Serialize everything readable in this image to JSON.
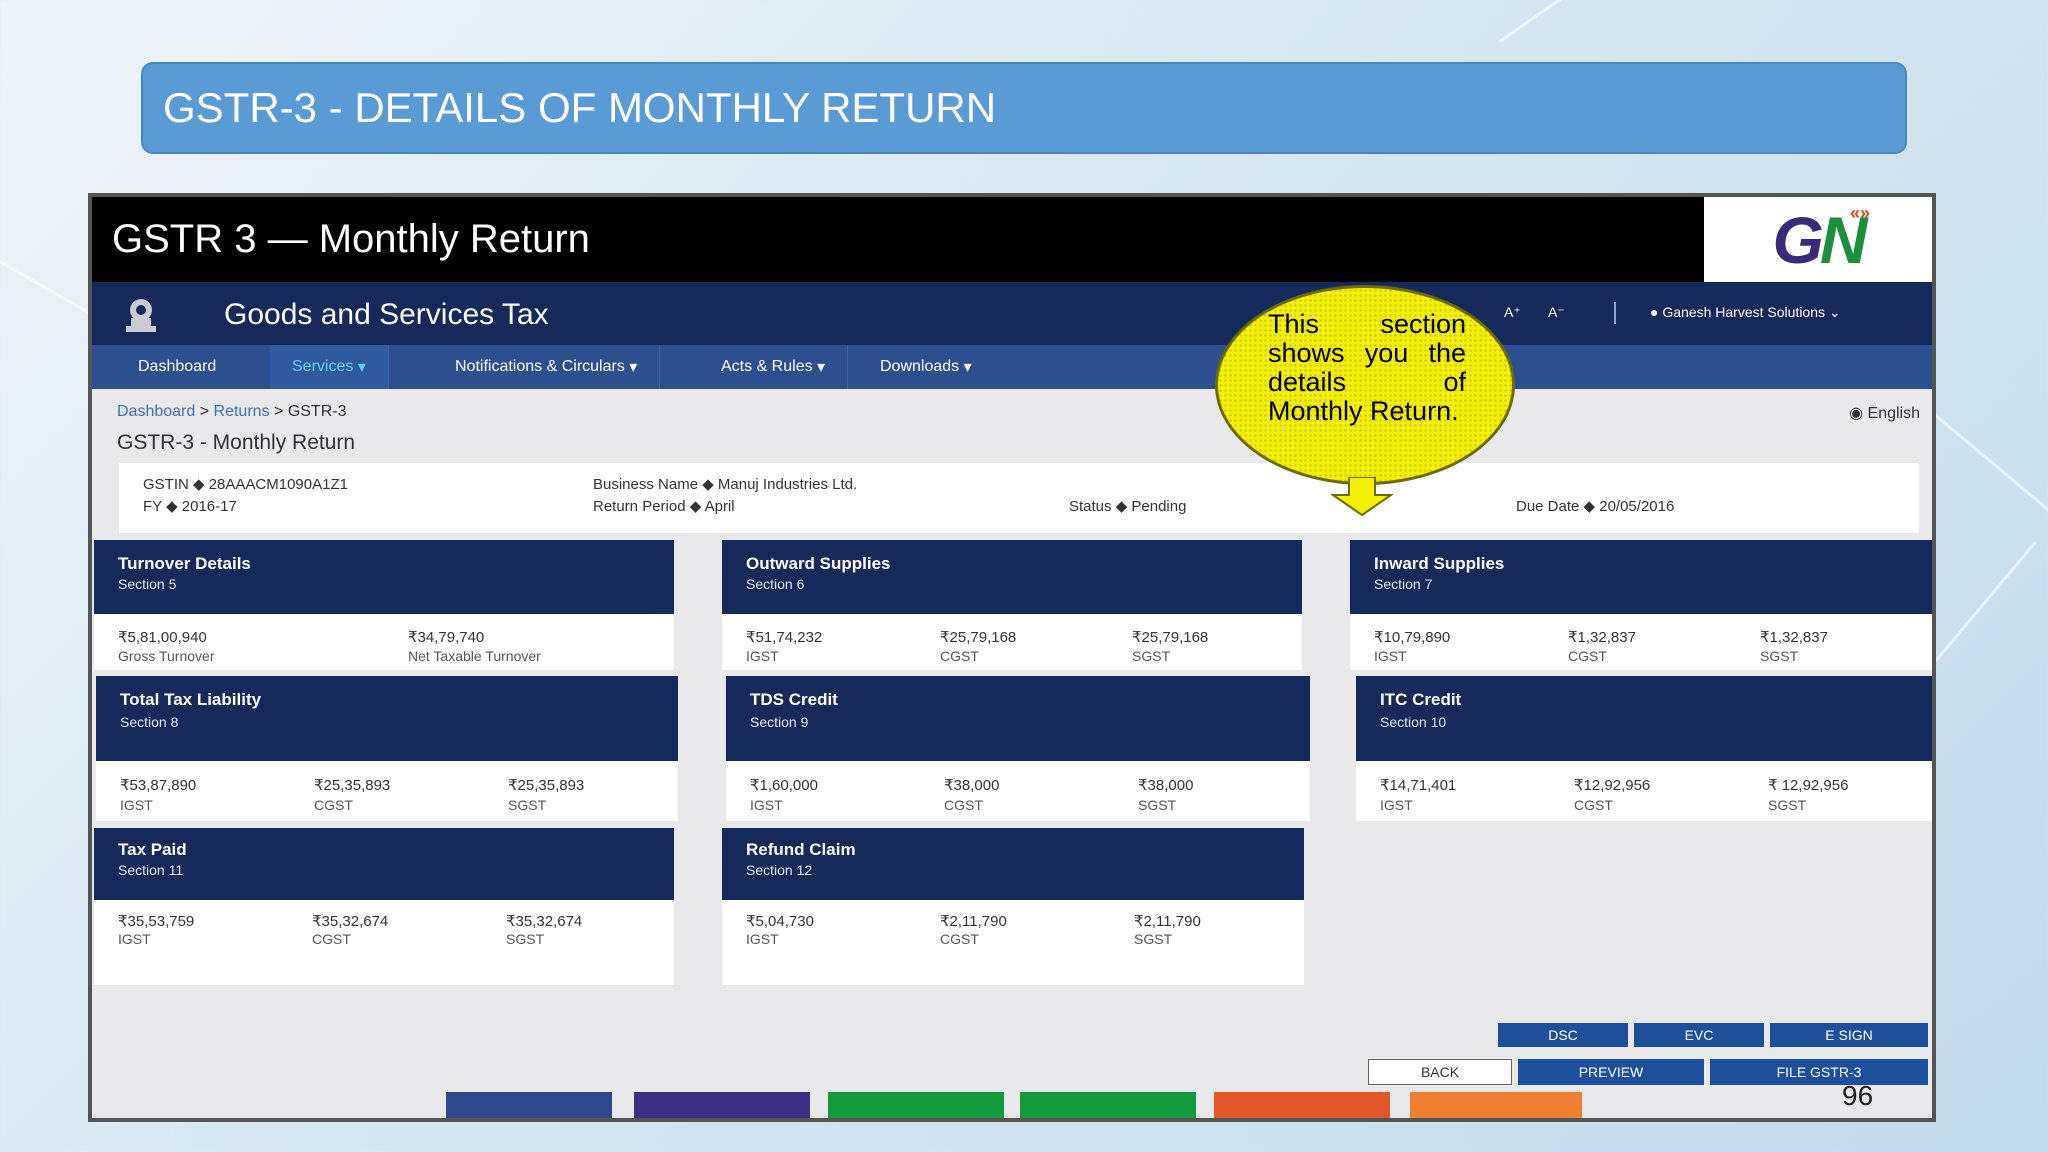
{
  "slide": {
    "title": "GSTR-3 - DETAILS OF MONTHLY RETURN",
    "page_number": "96"
  },
  "portal": {
    "window_title": "GSTR 3 — Monthly Return",
    "site_name": "Goods and Services Tax",
    "font_increase": "A⁺",
    "font_decrease": "A⁻",
    "user_name": "Ganesh Harvest Solutions",
    "language": "English"
  },
  "nav": [
    {
      "label": "Dashboard"
    },
    {
      "label": "Services"
    },
    {
      "label": "Notifications & Circulars"
    },
    {
      "label": "Acts & Rules"
    },
    {
      "label": "Downloads"
    }
  ],
  "breadcrumb": [
    "Dashboard",
    "Returns",
    "GSTR-3"
  ],
  "page_heading": "GSTR-3 - Monthly Return",
  "info": {
    "gstin": "GSTIN ◆ 28AAACM1090A1Z1",
    "fy": "FY ◆ 2016-17",
    "business_name": "Business Name ◆ Manuj Industries Ltd.",
    "return_period": "Return Period ◆ April",
    "status": "Status ◆ Pending",
    "due_date": "Due Date ◆ 20/05/2016"
  },
  "callout": {
    "text": "This section shows you the details of Monthly Return."
  },
  "cards": {
    "turnover": {
      "title": "Turnover Details",
      "section": "Section 5",
      "values": [
        {
          "value": "₹5,81,00,940",
          "label": "Gross Turnover"
        },
        {
          "value": "₹34,79,740",
          "label": "Net Taxable Turnover"
        }
      ]
    },
    "outward": {
      "title": "Outward Supplies",
      "section": "Section 6",
      "values": [
        {
          "value": "₹51,74,232",
          "label": "IGST"
        },
        {
          "value": "₹25,79,168",
          "label": "CGST"
        },
        {
          "value": "₹25,79,168",
          "label": "SGST"
        }
      ]
    },
    "inward": {
      "title": "Inward Supplies",
      "section": "Section 7",
      "values": [
        {
          "value": "₹10,79,890",
          "label": "IGST"
        },
        {
          "value": "₹1,32,837",
          "label": "CGST"
        },
        {
          "value": "₹1,32,837",
          "label": "SGST"
        }
      ]
    },
    "liability": {
      "title": "Total Tax Liability",
      "section": "Section 8",
      "values": [
        {
          "value": "₹53,87,890",
          "label": "IGST"
        },
        {
          "value": "₹25,35,893",
          "label": "CGST"
        },
        {
          "value": "₹25,35,893",
          "label": "SGST"
        }
      ]
    },
    "tds": {
      "title": "TDS Credit",
      "section": "Section 9",
      "values": [
        {
          "value": "₹1,60,000",
          "label": "IGST"
        },
        {
          "value": "₹38,000",
          "label": "CGST"
        },
        {
          "value": "₹38,000",
          "label": "SGST"
        }
      ]
    },
    "itc": {
      "title": "ITC Credit",
      "section": "Section 10",
      "values": [
        {
          "value": "₹14,71,401",
          "label": "IGST"
        },
        {
          "value": "₹12,92,956",
          "label": "CGST"
        },
        {
          "value": "₹ 12,92,956",
          "label": "SGST"
        }
      ]
    },
    "taxpaid": {
      "title": "Tax Paid",
      "section": "Section 11",
      "values": [
        {
          "value": "₹35,53,759",
          "label": "IGST"
        },
        {
          "value": "₹35,32,674",
          "label": "CGST"
        },
        {
          "value": "₹35,32,674",
          "label": "SGST"
        }
      ]
    },
    "refund": {
      "title": "Refund Claim",
      "section": "Section 12",
      "values": [
        {
          "value": "₹5,04,730",
          "label": "IGST"
        },
        {
          "value": "₹2,11,790",
          "label": "CGST"
        },
        {
          "value": "₹2,11,790",
          "label": "SGST"
        }
      ]
    }
  },
  "buttons": {
    "dsc": "DSC",
    "evc": "EVC",
    "esign": "E SIGN",
    "back": "BACK",
    "preview": "PREVIEW",
    "file": "FILE GSTR-3"
  },
  "colors": {
    "navy": "#152a5a",
    "nav_blue": "#2b4f8f",
    "button_blue": "#1d4f9d",
    "title_blue": "#5b9bd5",
    "callout_yellow": "#f5f000"
  }
}
